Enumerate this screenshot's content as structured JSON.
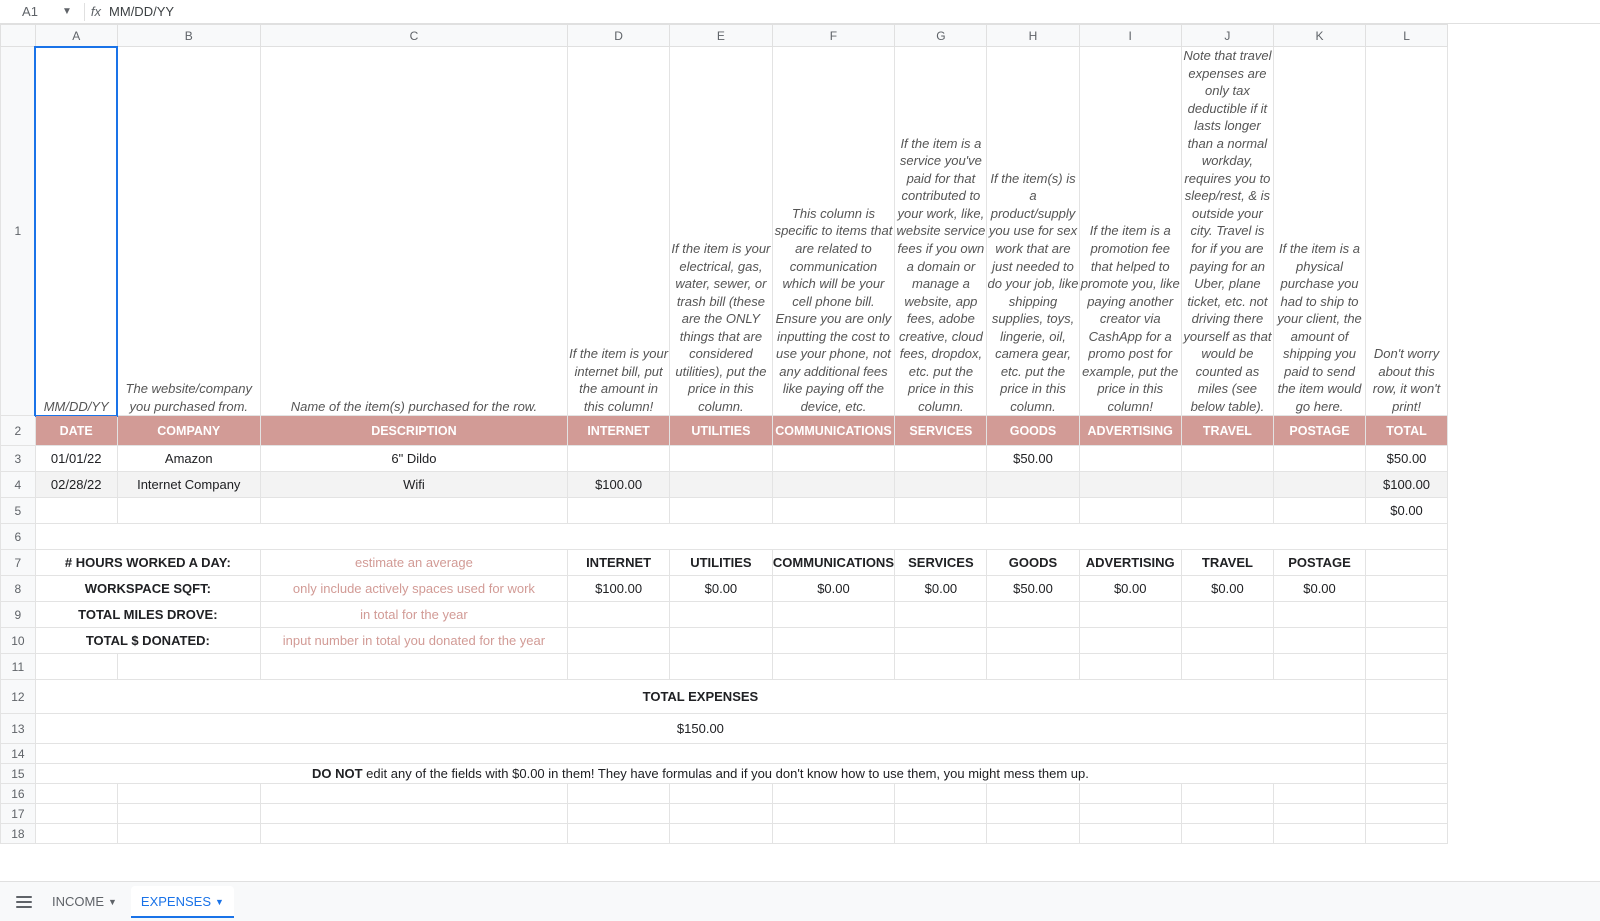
{
  "formulaBar": {
    "cellRef": "A1",
    "formula": "MM/DD/YY"
  },
  "columnLetters": [
    "A",
    "B",
    "C",
    "D",
    "E",
    "F",
    "G",
    "H",
    "I",
    "J",
    "K",
    "L"
  ],
  "row1": {
    "A": "MM/DD/YY",
    "B": "The website/company you purchased from.",
    "C": "Name of the item(s) purchased for the row.",
    "D": "If the item is your internet bill, put the amount in this column!",
    "E": "If the item is your electrical, gas, water, sewer, or trash bill (these are the ONLY things that are considered utilities), put the price in this column.",
    "F": "This column is specific to items that are related to communication which will be your cell phone bill. Ensure you are only inputting the cost to use your phone, not any additional fees like paying off the device, etc.",
    "G": "If the item is a service you've paid for that contributed to your work, like, website service fees if you own a domain or manage a website, app fees, adobe creative, cloud fees, dropdox, etc. put the price in this column.",
    "H": "If the item(s) is a product/supply you use for sex work that are just needed to do your job, like shipping supplies, toys, lingerie, oil, camera gear, etc. put the price in this column.",
    "I": "If the item is a promotion fee that helped to promote you, like paying another creator via CashApp for a promo post for example, put the price in this column!",
    "J": "Note that travel expenses are only tax deductible if it lasts longer than a normal workday, requires you to sleep/rest, & is outside your city. Travel is for if you are paying for an Uber, plane ticket, etc. not driving there yourself as that would be counted as miles (see below table).",
    "K": "If the item is a physical purchase you had to ship to your client, the amount of shipping you paid to send the item would go here.",
    "L": "Don't worry about this row, it won't print!"
  },
  "headers": {
    "DATE": "DATE",
    "COMPANY": "COMPANY",
    "DESCRIPTION": "DESCRIPTION",
    "INTERNET": "INTERNET",
    "UTILITIES": "UTILITIES",
    "COMMUNICATIONS": "COMMUNICATIONS",
    "SERVICES": "SERVICES",
    "GOODS": "GOODS",
    "ADVERTISING": "ADVERTISING",
    "TRAVEL": "TRAVEL",
    "POSTAGE": "POSTAGE",
    "TOTAL": "TOTAL"
  },
  "rows": [
    {
      "date": "01/01/22",
      "company": "Amazon",
      "description": "6\" Dildo",
      "internet": "",
      "utilities": "",
      "communications": "",
      "services": "",
      "goods": "$50.00",
      "advertising": "",
      "travel": "",
      "postage": "",
      "total": "$50.00"
    },
    {
      "date": "02/28/22",
      "company": "Internet Company",
      "description": "Wifi",
      "internet": "$100.00",
      "utilities": "",
      "communications": "",
      "services": "",
      "goods": "",
      "advertising": "",
      "travel": "",
      "postage": "",
      "total": "$100.00"
    },
    {
      "date": "",
      "company": "",
      "description": "",
      "internet": "",
      "utilities": "",
      "communications": "",
      "services": "",
      "goods": "",
      "advertising": "",
      "travel": "",
      "postage": "",
      "total": "$0.00"
    }
  ],
  "subLabels": {
    "hours": "# HOURS WORKED A DAY:",
    "sqft": "WORKSPACE SQFT:",
    "miles": "TOTAL MILES DROVE:",
    "donated": "TOTAL $ DONATED:"
  },
  "subHints": {
    "hours": "estimate an average",
    "sqft": "only include actively spaces used for work",
    "miles": "in total for the year",
    "donated": "input number in total you donated for the year"
  },
  "subHeaders2": {
    "INTERNET": "INTERNET",
    "UTILITIES": "UTILITIES",
    "COMMUNICATIONS": "COMMUNICATIONS",
    "SERVICES": "SERVICES",
    "GOODS": "GOODS",
    "ADVERTISING": "ADVERTISING",
    "TRAVEL": "TRAVEL",
    "POSTAGE": "POSTAGE"
  },
  "subTotals": {
    "INTERNET": "$100.00",
    "UTILITIES": "$0.00",
    "COMMUNICATIONS": "$0.00",
    "SERVICES": "$0.00",
    "GOODS": "$50.00",
    "ADVERTISING": "$0.00",
    "TRAVEL": "$0.00",
    "POSTAGE": "$0.00"
  },
  "totalExpenses": {
    "title": "TOTAL EXPENSES",
    "amount": "$150.00"
  },
  "warning": {
    "bold": "DO NOT",
    "rest": " edit any of the fields with $0.00 in them! They have formulas and if you don't know how to use them, you might mess them up."
  },
  "tabs": {
    "income": "INCOME",
    "expenses": "EXPENSES"
  },
  "rowNumbers": [
    "1",
    "2",
    "3",
    "4",
    "5",
    "6",
    "7",
    "8",
    "9",
    "10",
    "11",
    "12",
    "13",
    "14",
    "15",
    "16",
    "17",
    "18"
  ]
}
